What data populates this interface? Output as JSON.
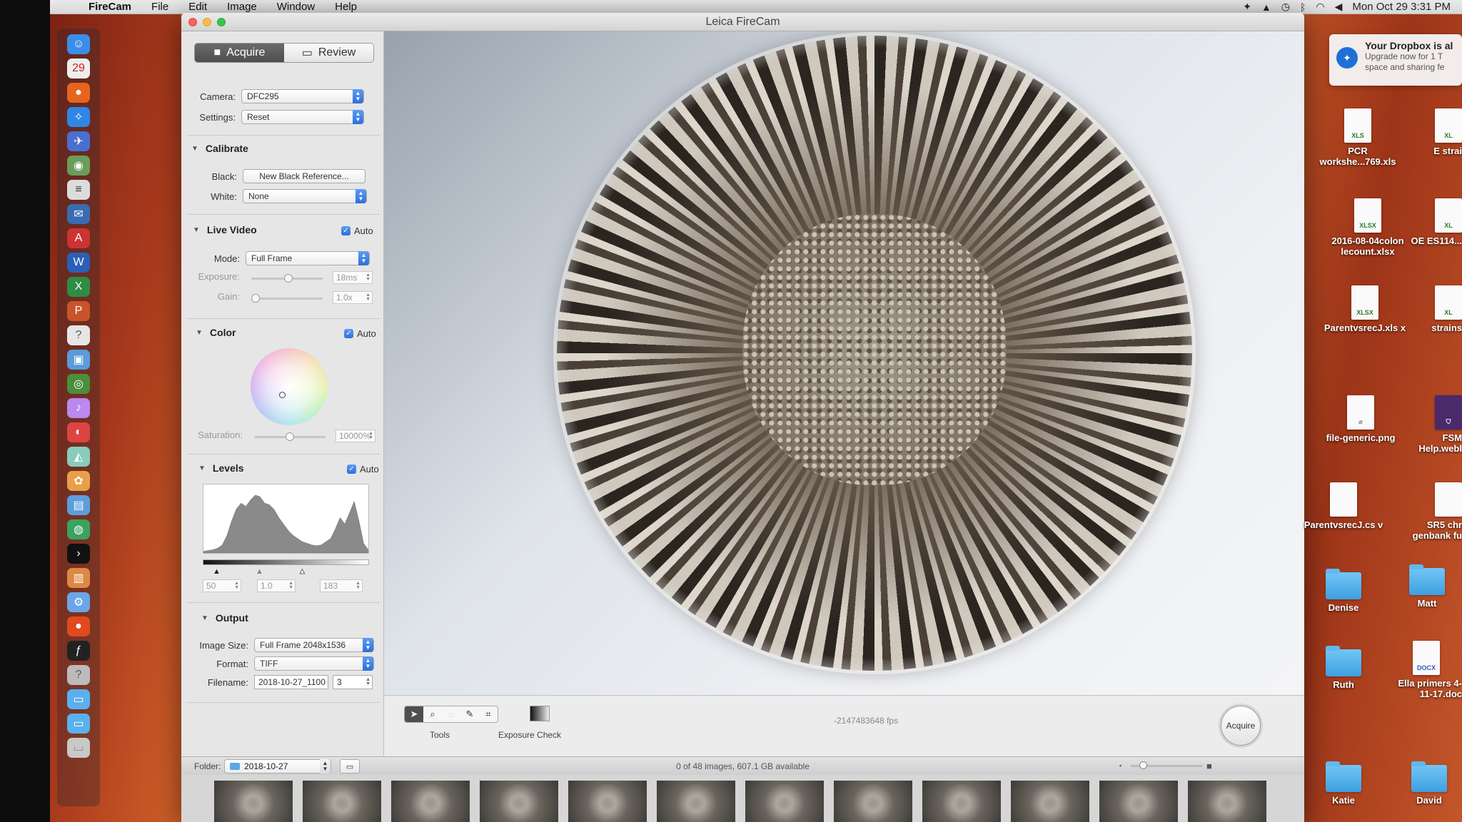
{
  "menubar": {
    "apple_icon": "apple-icon",
    "app_name": "FireCam",
    "menus": [
      "File",
      "Edit",
      "Image",
      "Window",
      "Help"
    ],
    "clock": "Mon Oct 29  3:31 PM",
    "status_icons": [
      "dropbox-icon",
      "cap-icon",
      "time-machine-icon",
      "bluetooth-icon",
      "wifi-icon",
      "volume-icon"
    ]
  },
  "window": {
    "title": "Leica FireCam"
  },
  "panel": {
    "tab_acquire": "Acquire",
    "tab_review": "Review",
    "camera_label": "Camera:",
    "camera_value": "DFC295",
    "settings_label": "Settings:",
    "settings_value": "Reset",
    "calibrate": {
      "title": "Calibrate",
      "black_label": "Black:",
      "black_button": "New Black Reference...",
      "white_label": "White:",
      "white_value": "None"
    },
    "live_video": {
      "title": "Live Video",
      "auto_label": "Auto",
      "mode_label": "Mode:",
      "mode_value": "Full Frame",
      "exposure_label": "Exposure:",
      "exposure_value": "18ms",
      "gain_label": "Gain:",
      "gain_value": "1.0x"
    },
    "color": {
      "title": "Color",
      "auto_label": "Auto",
      "saturation_label": "Saturation:",
      "saturation_value": "10000%"
    },
    "levels": {
      "title": "Levels",
      "auto_label": "Auto",
      "black_value": "50",
      "gamma_value": "1.0",
      "white_value": "183"
    },
    "output": {
      "title": "Output",
      "image_size_label": "Image Size:",
      "image_size_value": "Full Frame 2048x1536",
      "format_label": "Format:",
      "format_value": "TIFF",
      "filename_label": "Filename:",
      "filename_value": "2018-10-27_1100",
      "filename_counter": "3"
    }
  },
  "viewer": {
    "tools_caption": "Tools",
    "exposure_check_caption": "Exposure Check",
    "fps_text": "-2147483648 fps",
    "acquire_button": "Acquire"
  },
  "statusbar": {
    "folder_label": "Folder:",
    "folder_value": "2018-10-27",
    "status_text": "0 of 48 images, 607.1 GB available"
  },
  "notification": {
    "title": "Your Dropbox is al",
    "body_line1": "Upgrade now for 1 T",
    "body_line2": "space and sharing fe"
  },
  "desktop": {
    "items": [
      {
        "name": "PCR workshe...769.xls",
        "kind": "xls"
      },
      {
        "name": "E strai",
        "kind": "xls"
      },
      {
        "name": "2016-08-04colon lecount.xlsx",
        "kind": "xlsx"
      },
      {
        "name": "OE ES114...",
        "kind": "xlsx"
      },
      {
        "name": "ParentvsrecJ.xls x",
        "kind": "xlsx"
      },
      {
        "name": "strains",
        "kind": "xlsx"
      },
      {
        "name": "file-generic.png",
        "kind": "png"
      },
      {
        "name": "FSM Help.webl",
        "kind": "webloc"
      },
      {
        "name": "ParentvsrecJ.cs v",
        "kind": "csv"
      },
      {
        "name": "SR5 chr genbank fu",
        "kind": "doc"
      },
      {
        "name": "Denise",
        "kind": "folder"
      },
      {
        "name": "Matt",
        "kind": "folder"
      },
      {
        "name": "Ruth",
        "kind": "folder"
      },
      {
        "name": "Ella primers 4-11-17.doc",
        "kind": "docx"
      },
      {
        "name": "Katie",
        "kind": "folder"
      },
      {
        "name": "David",
        "kind": "folder"
      }
    ]
  },
  "histogram": {
    "values": [
      2,
      3,
      4,
      6,
      10,
      22,
      40,
      55,
      62,
      58,
      66,
      72,
      70,
      62,
      60,
      54,
      44,
      36,
      28,
      22,
      18,
      14,
      12,
      10,
      9,
      10,
      14,
      18,
      30,
      44,
      36,
      50,
      64,
      40,
      12,
      4
    ]
  }
}
